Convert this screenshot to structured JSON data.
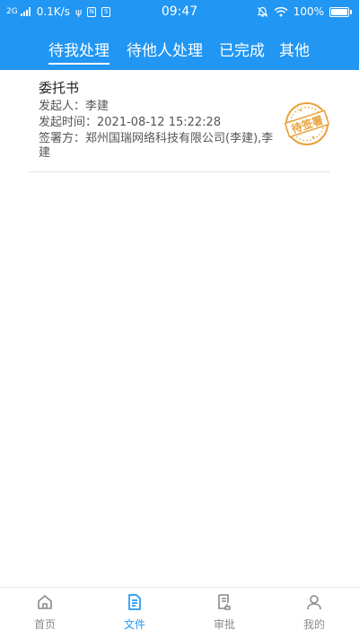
{
  "status_bar": {
    "network": "2G",
    "speed": "0.1K/s",
    "time": "09:47",
    "battery": "100%",
    "battery_level": 1.0
  },
  "tabs": [
    {
      "label": "待我处理",
      "active": true
    },
    {
      "label": "待他人处理",
      "active": false
    },
    {
      "label": "已完成",
      "active": false
    },
    {
      "label": "其他",
      "active": false
    }
  ],
  "documents": [
    {
      "title": "委托书",
      "initiator_label": "发起人：",
      "initiator": "李建",
      "time_label": "发起时间：",
      "time": "2021-08-12 15:22:28",
      "signer_label": "签署方：",
      "signers": "郑州国瑞网络科技有限公司(李建),李建",
      "stamp_text": "待签署"
    }
  ],
  "bottom_nav": [
    {
      "label": "首页",
      "icon": "home-icon",
      "active": false
    },
    {
      "label": "文件",
      "icon": "file-icon",
      "active": true
    },
    {
      "label": "审批",
      "icon": "approval-icon",
      "active": false
    },
    {
      "label": "我的",
      "icon": "user-icon",
      "active": false
    }
  ],
  "colors": {
    "primary": "#2196F3",
    "stamp": "#E8A23A",
    "nav_inactive": "#8a8a8a"
  }
}
